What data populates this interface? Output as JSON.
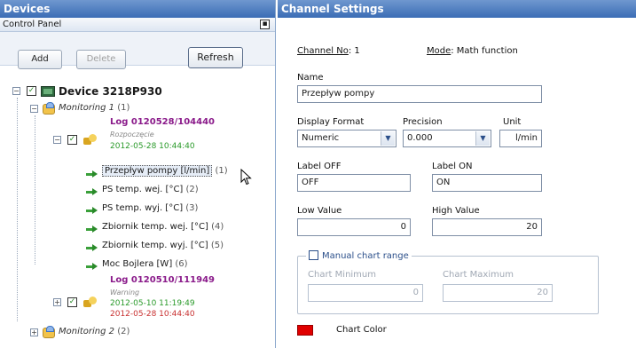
{
  "left_panel": {
    "title": "Devices",
    "subheader": "Control Panel",
    "buttons": {
      "add": "Add",
      "delete": "Delete",
      "refresh": "Refresh"
    }
  },
  "tree": {
    "device": "Device 3218P930",
    "monitoring1": {
      "label": "Monitoring 1",
      "count": "(1)"
    },
    "log1": {
      "name": "Log 0120528/104440",
      "state": "Rozpoczęcie",
      "ts": "2012-05-28 10:44:40"
    },
    "channels": [
      {
        "label": "Przepływ pompy [l/min]",
        "idx": "(1)"
      },
      {
        "label": "PS temp. wej. [°C]",
        "idx": "(2)"
      },
      {
        "label": "PS temp. wyj. [°C]",
        "idx": "(3)"
      },
      {
        "label": "Zbiornik temp. wej. [°C]",
        "idx": "(4)"
      },
      {
        "label": "Zbiornik temp. wyj. [°C]",
        "idx": "(5)"
      },
      {
        "label": "Moc Bojlera [W]",
        "idx": "(6)"
      }
    ],
    "log2": {
      "name": "Log 0120510/111949",
      "state": "Warning",
      "ts1": "2012-05-10 11:19:49",
      "ts2": "2012-05-28 10:44:40"
    },
    "monitoring2": {
      "label": "Monitoring 2",
      "count": "(2)"
    }
  },
  "right_panel": {
    "title": "Channel Settings",
    "channel_no_label": "Channel No",
    "channel_no_value": ": 1",
    "mode_label": "Mode",
    "mode_value": ": Math function",
    "name_label": "Name",
    "name_value": "Przepływ pompy",
    "display_format_label": "Display Format",
    "display_format_value": "Numeric",
    "precision_label": "Precision",
    "precision_value": "0.000",
    "unit_label": "Unit",
    "unit_value": "l/min",
    "label_off_label": "Label OFF",
    "label_off_value": "OFF",
    "label_on_label": "Label ON",
    "label_on_value": "ON",
    "low_value_label": "Low Value",
    "low_value": "0",
    "high_value_label": "High Value",
    "high_value": "20",
    "manual_range_label": "Manual chart range",
    "chart_min_label": "Chart Minimum",
    "chart_min_value": "0",
    "chart_max_label": "Chart Maximum",
    "chart_max_value": "20",
    "chart_color_label": "Chart Color",
    "chart_color": "#e00000"
  }
}
